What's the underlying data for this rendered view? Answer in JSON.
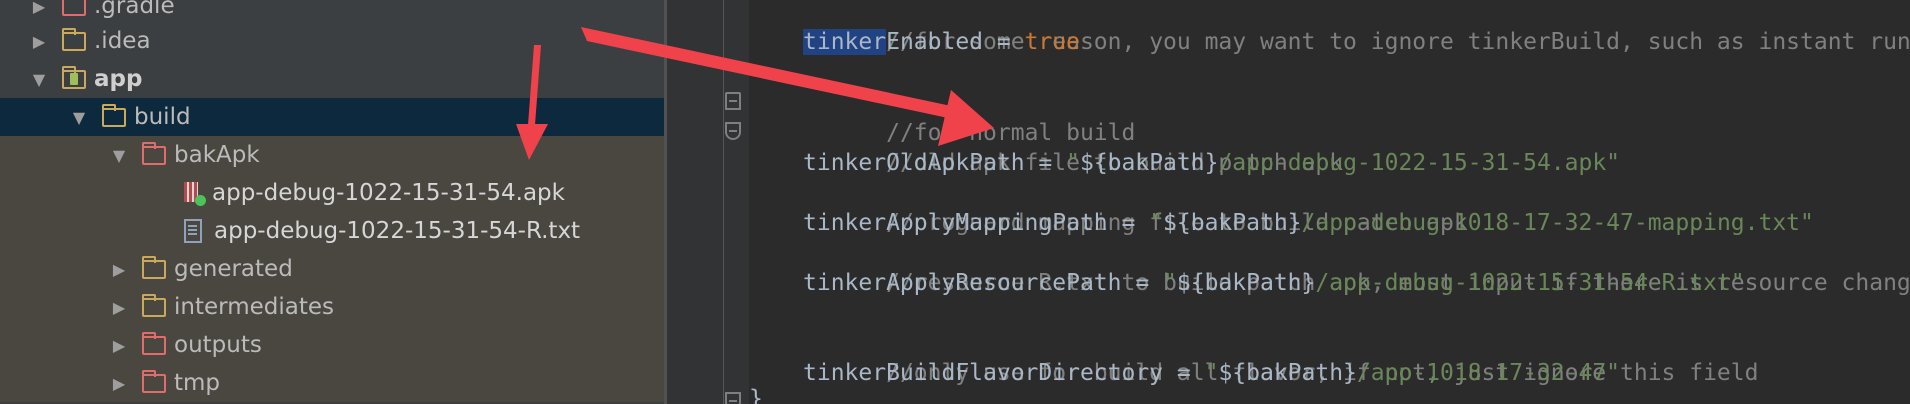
{
  "tree": {
    "items": [
      {
        "label": ".gradle",
        "icon": "folder-red-icon"
      },
      {
        "label": ".idea",
        "icon": "folder-icon"
      },
      {
        "label": "app",
        "icon": "module-folder-icon"
      },
      {
        "label": "build",
        "icon": "folder-icon"
      },
      {
        "label": "bakApk",
        "icon": "folder-red-icon"
      },
      {
        "label": "app-debug-1022-15-31-54.apk",
        "icon": "apk-file-icon"
      },
      {
        "label": "app-debug-1022-15-31-54-R.txt",
        "icon": "text-file-icon"
      },
      {
        "label": "generated",
        "icon": "folder-icon"
      },
      {
        "label": "intermediates",
        "icon": "folder-icon"
      },
      {
        "label": "outputs",
        "icon": "folder-red-icon"
      },
      {
        "label": "tmp",
        "icon": "folder-red-icon"
      }
    ]
  },
  "editor": {
    "line1": {
      "comment": "//for some reason, you may want to ignore tinkerBuild, such as instant run debug build?"
    },
    "line2": {
      "var_hl": "tinker",
      "var_rest": "Enabled",
      "op": " = ",
      "keyword": "true"
    },
    "line4": {
      "comment": "//for normal build"
    },
    "line5": {
      "comment": "//old apk file to build patch apk"
    },
    "line6": {
      "var": "tinkerOldApkPath",
      "op": " = ",
      "q1": "\"",
      "interp": "${bakPath}",
      "str": "/app-debug-1022-15-31-54.apk\""
    },
    "line7": {
      "comment": "//proguard mapping file to build patch apk"
    },
    "line8": {
      "var": "tinkerApplyMappingPath",
      "op": " = ",
      "q1": "\"",
      "interp": "${bakPath}",
      "str": "/app-debug-1018-17-32-47-mapping.txt\""
    },
    "line9": {
      "comment": "//resource R.txt to build patch apk, must input if there is resource changed"
    },
    "line10": {
      "var": "tinkerApplyResourcePath",
      "op": " = ",
      "q1": "\"",
      "interp": "${bakPath}",
      "str": "/app-debug-1022-15-31-54-R.txt\""
    },
    "line12": {
      "comment": "//only use for build all flavor, if not, just ignore this field"
    },
    "line13": {
      "var": "tinkerBuildFlavorDirectory",
      "op": " = ",
      "q1": "\"",
      "interp": "${bakPath}",
      "str": "/app-1018-17-32-47\""
    },
    "closing_brace": "}"
  },
  "colors": {
    "annotation_arrow": "#f0424b",
    "comment": "#808080",
    "string": "#6a8759",
    "keyword": "#cc7832",
    "selection": "#0d293e"
  }
}
